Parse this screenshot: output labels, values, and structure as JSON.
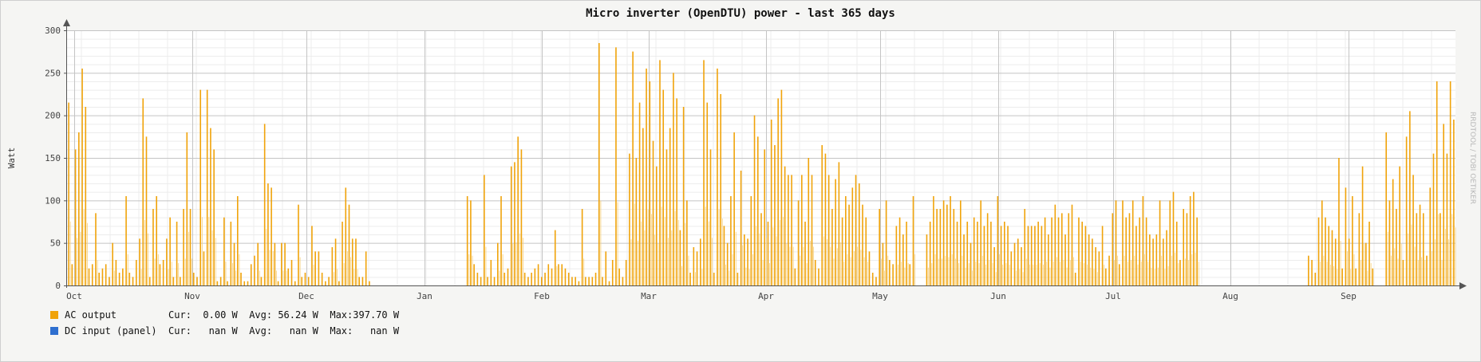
{
  "chart_data": {
    "type": "bar",
    "title": "Micro inverter (OpenDTU) power - last 365 days",
    "ylabel": "Watt",
    "xlabel": "",
    "ylim": [
      0,
      300
    ],
    "yticks": [
      "0",
      "50",
      "100",
      "150",
      "200",
      "250",
      "300"
    ],
    "xticks": [
      "Oct",
      "Nov",
      "Dec",
      "Jan",
      "Feb",
      "Mar",
      "Apr",
      "May",
      "Jun",
      "Jul",
      "Aug",
      "Sep"
    ],
    "grid": true,
    "watermark": "RRDTOOL / TOBI OETIKER",
    "series": [
      {
        "name": "AC output",
        "color": "#f0a30a",
        "start_month_label": "Oct",
        "daily_max": [
          215,
          25,
          160,
          180,
          255,
          210,
          20,
          25,
          85,
          15,
          20,
          25,
          10,
          50,
          30,
          15,
          20,
          105,
          15,
          10,
          30,
          55,
          220,
          175,
          10,
          90,
          105,
          25,
          30,
          55,
          80,
          10,
          75,
          10,
          90,
          180,
          90,
          15,
          10,
          230,
          40,
          230,
          185,
          160,
          5,
          10,
          80,
          5,
          75,
          50,
          105,
          15,
          5,
          5,
          25,
          35,
          50,
          10,
          190,
          120,
          115,
          50,
          5,
          50,
          50,
          20,
          30,
          5,
          95,
          10,
          15,
          10,
          70,
          40,
          40,
          15,
          5,
          10,
          45,
          55,
          5,
          75,
          115,
          95,
          55,
          55,
          10,
          10,
          40,
          5,
          0,
          0,
          0,
          0,
          0,
          0,
          0,
          0,
          0,
          0,
          0,
          0,
          0,
          0,
          0,
          0,
          0,
          0,
          0,
          0,
          0,
          0,
          0,
          0,
          0,
          0,
          0,
          0,
          105,
          100,
          25,
          15,
          10,
          130,
          10,
          30,
          10,
          50,
          105,
          15,
          20,
          140,
          145,
          175,
          160,
          15,
          10,
          15,
          20,
          25,
          10,
          15,
          25,
          20,
          65,
          25,
          25,
          20,
          15,
          10,
          10,
          5,
          90,
          10,
          10,
          10,
          15,
          285,
          10,
          40,
          5,
          30,
          280,
          20,
          10,
          30,
          155,
          275,
          150,
          215,
          185,
          255,
          240,
          170,
          140,
          265,
          230,
          160,
          185,
          250,
          220,
          65,
          210,
          100,
          15,
          45,
          40,
          55,
          265,
          215,
          160,
          15,
          255,
          225,
          70,
          50,
          105,
          180,
          15,
          135,
          60,
          55,
          105,
          200,
          175,
          85,
          160,
          75,
          195,
          165,
          220,
          230,
          140,
          130,
          130,
          20,
          100,
          130,
          75,
          150,
          130,
          30,
          20,
          165,
          155,
          130,
          90,
          125,
          145,
          80,
          105,
          95,
          115,
          130,
          120,
          95,
          80,
          40,
          15,
          10,
          90,
          50,
          100,
          30,
          25,
          70,
          80,
          60,
          75,
          25,
          105,
          0,
          0,
          0,
          60,
          75,
          105,
          90,
          90,
          100,
          95,
          105,
          90,
          75,
          100,
          60,
          75,
          50,
          80,
          75,
          100,
          70,
          85,
          75,
          45,
          105,
          70,
          75,
          70,
          40,
          50,
          55,
          45,
          90,
          70,
          70,
          70,
          75,
          70,
          80,
          60,
          80,
          95,
          80,
          85,
          60,
          85,
          95,
          15,
          80,
          75,
          70,
          60,
          55,
          45,
          40,
          70,
          20,
          35,
          85,
          100,
          25,
          100,
          80,
          85,
          100,
          70,
          80,
          105,
          80,
          60,
          55,
          60,
          100,
          55,
          65,
          100,
          110,
          75,
          30,
          90,
          85,
          105,
          110,
          80,
          0,
          0,
          0,
          0,
          0,
          0,
          0,
          0,
          0,
          0,
          0,
          0,
          0,
          0,
          0,
          0,
          0,
          0,
          0,
          0,
          0,
          0,
          0,
          0,
          0,
          0,
          0,
          0,
          0,
          0,
          0,
          0,
          35,
          30,
          15,
          80,
          100,
          80,
          70,
          65,
          55,
          150,
          20,
          115,
          55,
          105,
          20,
          85,
          140,
          50,
          75,
          20,
          0,
          0,
          0,
          180,
          100,
          125,
          90,
          140,
          30,
          175,
          205,
          130,
          85,
          95,
          85,
          35,
          115,
          155,
          240,
          85,
          190,
          155,
          240,
          195
        ],
        "cur": "  0.00 W",
        "avg": " 56.24 W",
        "max": "397.70 W"
      },
      {
        "name": "DC input (panel)",
        "color": "#2f6fcf",
        "cur": "   nan W",
        "avg": "   nan W",
        "max": "   nan W"
      }
    ]
  },
  "legend": {
    "rows": [
      {
        "swatch": "#f0a30a",
        "name": "AC output       ",
        "cur_label": "Cur:",
        "cur": "  0.00 W",
        "avg_label": "Avg:",
        "avg": " 56.24 W",
        "max_label": "Max:",
        "max": "397.70 W"
      },
      {
        "swatch": "#2f6fcf",
        "name": "DC input (panel)",
        "cur_label": "Cur:",
        "cur": "   nan W",
        "avg_label": "Avg:",
        "avg": "   nan W",
        "max_label": "Max:",
        "max": "   nan W"
      }
    ]
  }
}
